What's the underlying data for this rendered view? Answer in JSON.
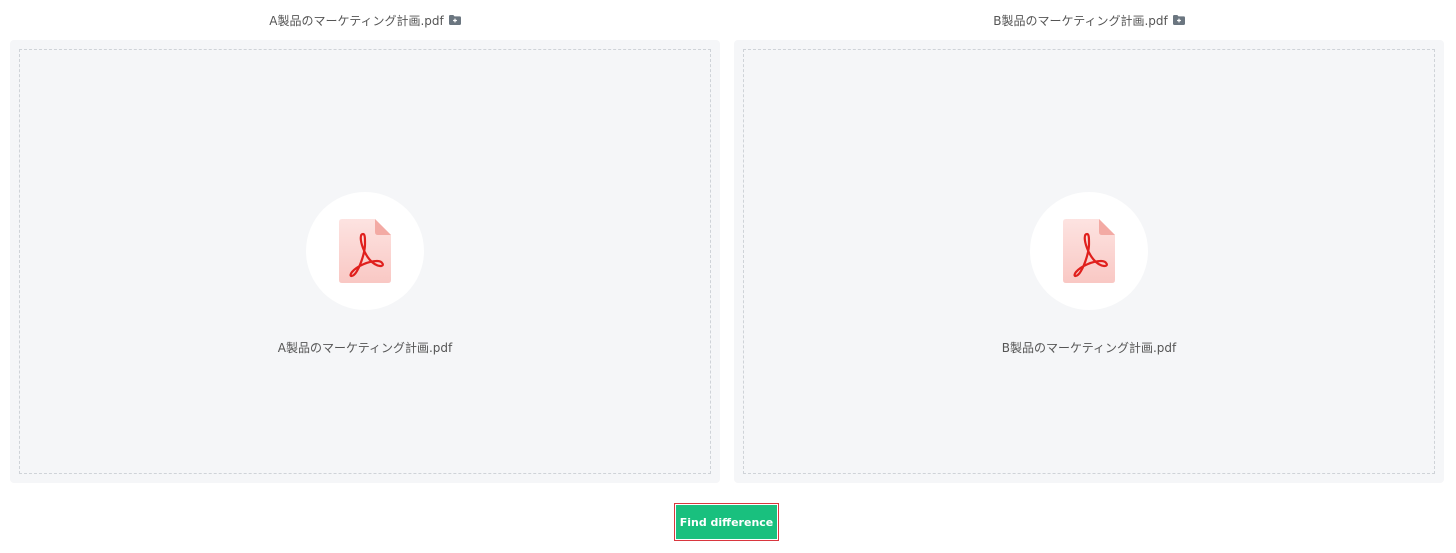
{
  "left_panel": {
    "header_title": "A製品のマーケティング計画.pdf",
    "header_icon": "folder-icon",
    "file_icon": "pdf-file-icon",
    "file_name": "A製品のマーケティング計画.pdf"
  },
  "right_panel": {
    "header_title": "B製品のマーケティング計画.pdf",
    "header_icon": "folder-icon",
    "file_icon": "pdf-file-icon",
    "file_name": "B製品のマーケティング計画.pdf"
  },
  "action": {
    "find_label": "Find difference"
  },
  "colors": {
    "accent_green": "#19c07e",
    "highlight_red": "#d9363e",
    "drop_bg": "#f5f6f8",
    "pdf_red": "#e0201d"
  }
}
